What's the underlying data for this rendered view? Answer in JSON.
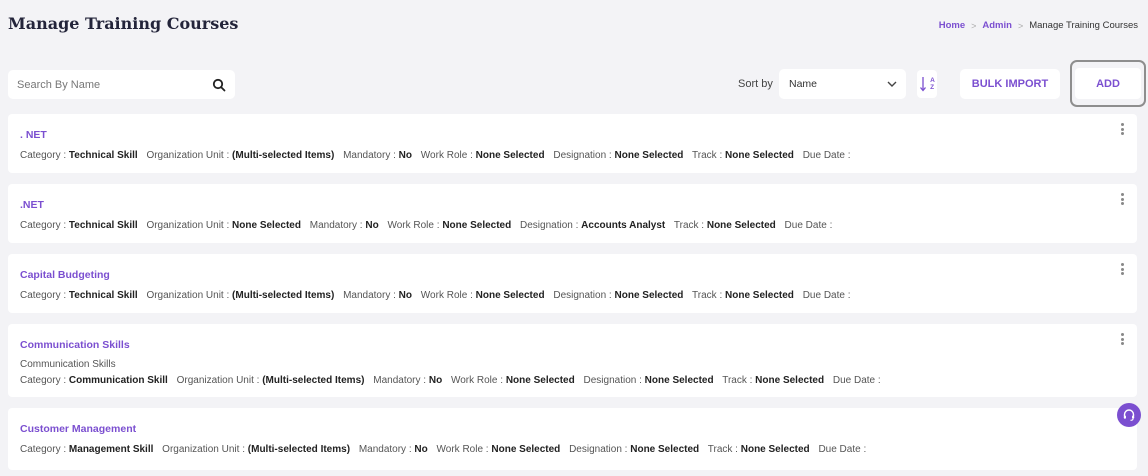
{
  "header": {
    "title": "Manage Training Courses",
    "breadcrumb": {
      "home": "Home",
      "sep1": ">",
      "admin": "Admin",
      "sep2": ">",
      "current": "Manage Training Courses"
    }
  },
  "toolbar": {
    "search_placeholder": "Search By Name",
    "sort_label": "Sort by",
    "sort_value": "Name",
    "sort_order_glyph_top": "A",
    "sort_order_glyph_bottom": "Z",
    "bulk_import_label": "BULK IMPORT",
    "add_label": "ADD"
  },
  "labels": {
    "category": "Category :",
    "org_unit": "Organization Unit :",
    "mandatory": "Mandatory :",
    "work_role": "Work Role :",
    "designation": "Designation :",
    "track": "Track :",
    "due_date": "Due Date :"
  },
  "courses": [
    {
      "name": ". NET",
      "description": "",
      "category": "Technical Skill",
      "org_unit": "(Multi-selected Items)",
      "mandatory": "No",
      "work_role": "None Selected",
      "designation": "None Selected",
      "track": "None Selected",
      "due_date": ""
    },
    {
      "name": ".NET",
      "description": "",
      "category": "Technical Skill",
      "org_unit": "None Selected",
      "mandatory": "No",
      "work_role": "None Selected",
      "designation": "Accounts Analyst",
      "track": "None Selected",
      "due_date": ""
    },
    {
      "name": "Capital Budgeting",
      "description": "",
      "category": "Technical Skill",
      "org_unit": "(Multi-selected Items)",
      "mandatory": "No",
      "work_role": "None Selected",
      "designation": "None Selected",
      "track": "None Selected",
      "due_date": ""
    },
    {
      "name": "Communication Skills",
      "description": "Communication Skills",
      "category": "Communication Skill",
      "org_unit": "(Multi-selected Items)",
      "mandatory": "No",
      "work_role": "None Selected",
      "designation": "None Selected",
      "track": "None Selected",
      "due_date": ""
    },
    {
      "name": "Customer Management",
      "description": "",
      "category": "Management Skill",
      "org_unit": "(Multi-selected Items)",
      "mandatory": "No",
      "work_role": "None Selected",
      "designation": "None Selected",
      "track": "None Selected",
      "due_date": ""
    }
  ],
  "colors": {
    "accent": "#7b4fd0",
    "background": "#f3f3f6",
    "title": "#23243a"
  },
  "icons": {
    "search": "search-icon",
    "sort": "chevron-down-icon",
    "more": "kebab-icon",
    "support": "headset-icon"
  }
}
